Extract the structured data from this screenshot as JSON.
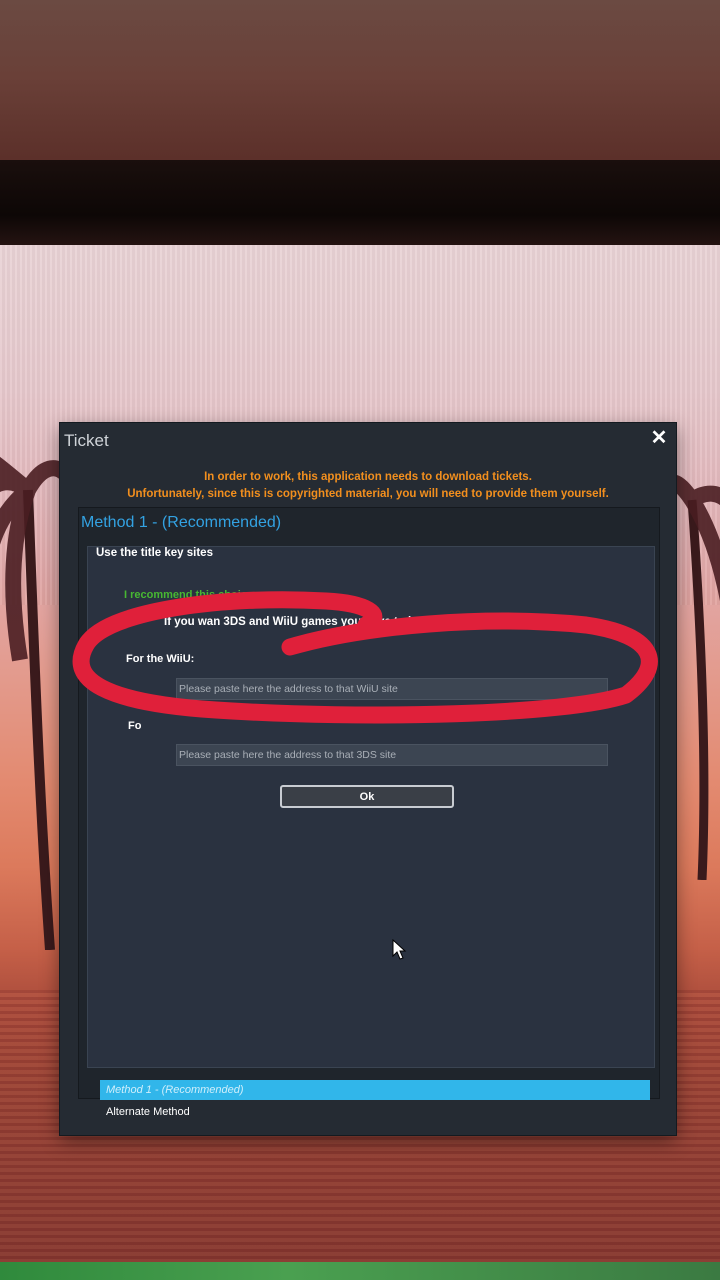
{
  "window": {
    "title": "Ticket",
    "close_glyph": "✕"
  },
  "notice": {
    "line1": "In order to work, this application needs to download tickets.",
    "line2": "Unfortunately, since this is copyrighted material, you will need to provide them yourself.",
    "color": "#f28f1e"
  },
  "method": {
    "header": "Method 1 - (Recommended)",
    "group_title": "Use the title key sites",
    "recommend": "I recommend this choice.",
    "instruction": "If you wan                             3DS and WiiU games you have to input both urls.",
    "wiiu_label": "For the WiiU:",
    "wiiu_placeholder": "Please paste here the address to that WiiU site",
    "ds_label": "Fo",
    "ds_placeholder": "Please paste here the address to that 3DS site",
    "ok_label": "Ok"
  },
  "tabs": {
    "items": [
      {
        "label": "Method 1 - (Recommended)"
      },
      {
        "label": "Alternate Method"
      }
    ],
    "accent": "#31b6ea"
  },
  "icons": {
    "close": "close-icon",
    "cursor": "mouse-cursor-icon"
  }
}
